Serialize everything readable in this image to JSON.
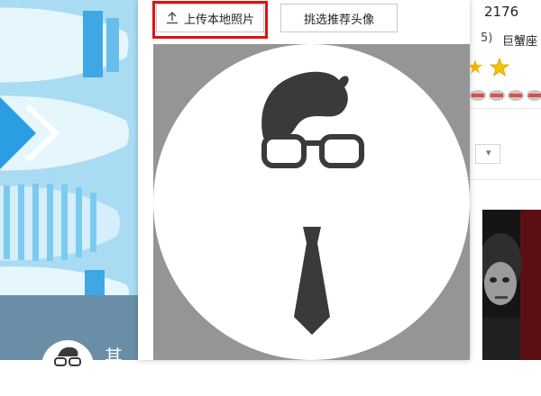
{
  "dialog": {
    "upload_button_label": "上传本地照片",
    "pick_avatar_button_label": "挑选推荐头像"
  },
  "left_panel": {
    "partial_text": "其"
  },
  "right_panel": {
    "partial_id": "2176",
    "bracket_text": "5)",
    "zodiac": "巨蟹座",
    "dropdown_arrow": "▾"
  },
  "colors": {
    "highlight": "#e01111",
    "preview_bg": "#959595",
    "wallpaper": "#a9dcf3"
  }
}
